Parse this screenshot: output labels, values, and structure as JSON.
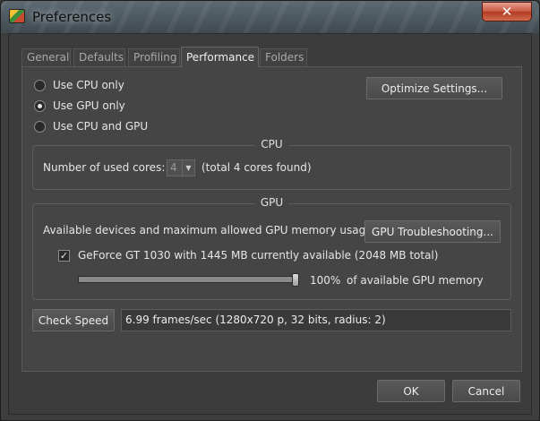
{
  "window": {
    "title": "Preferences"
  },
  "tabs": [
    {
      "label": "General",
      "active": false
    },
    {
      "label": "Defaults",
      "active": false
    },
    {
      "label": "Profiling",
      "active": false
    },
    {
      "label": "Performance",
      "active": true
    },
    {
      "label": "Folders",
      "active": false
    }
  ],
  "mode": {
    "options": [
      {
        "label": "Use CPU only",
        "checked": false
      },
      {
        "label": "Use GPU only",
        "checked": true
      },
      {
        "label": "Use CPU and GPU",
        "checked": false
      }
    ],
    "optimize_button": "Optimize Settings..."
  },
  "cpu": {
    "title": "CPU",
    "cores_label": "Number of used cores:",
    "cores_value": "4",
    "cores_note": "(total 4 cores found)"
  },
  "gpu": {
    "title": "GPU",
    "devices_label": "Available devices and maximum allowed GPU memory usage:",
    "troubleshoot_button": "GPU Troubleshooting...",
    "device": {
      "label": "GeForce GT 1030 with 1445 MB currently available (2048 MB total)",
      "checked": true
    },
    "memory": {
      "percent_label": "100%",
      "unit_label": "of available GPU memory",
      "fraction": 1.0
    }
  },
  "speed": {
    "button": "Check Speed",
    "result": "6.99 frames/sec (1280x720 p, 32 bits, radius: 2)"
  },
  "footer": {
    "ok": "OK",
    "cancel": "Cancel"
  },
  "icons": {
    "app": "app-logo-icon",
    "close": "close-icon",
    "dropdown": "chevron-down-icon",
    "check": "checkmark-icon"
  }
}
